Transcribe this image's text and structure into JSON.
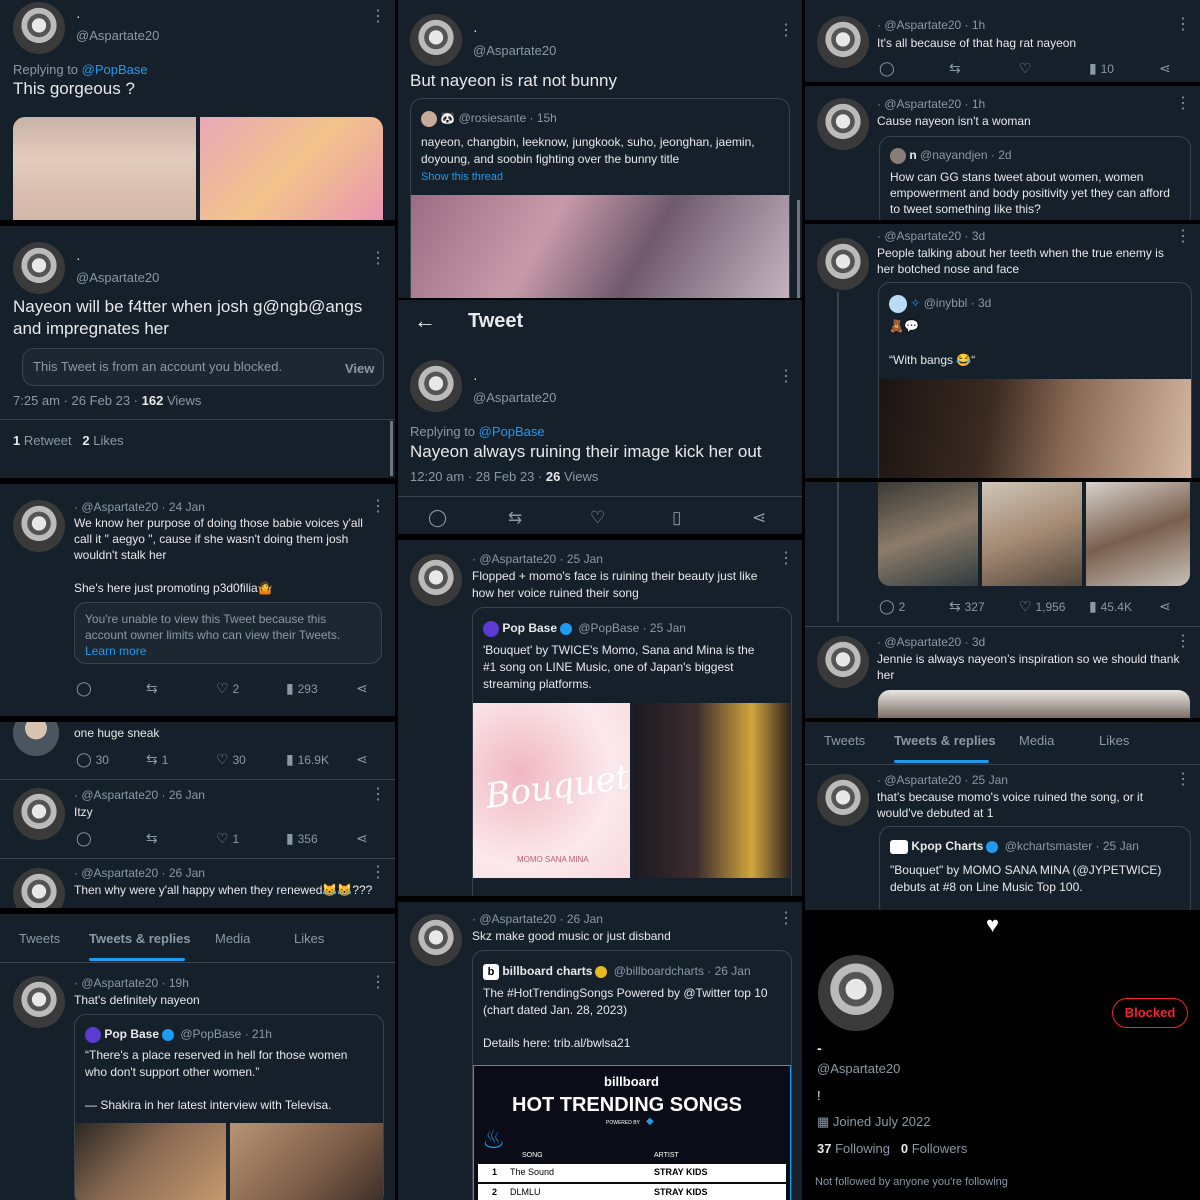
{
  "user": {
    "name": "·",
    "handle": "@Aspartate20"
  },
  "p1": {
    "replying": "Replying to",
    "replying_to": "@PopBase",
    "text": "This gorgeous ?"
  },
  "p2": {
    "text1": "Nayeon will be f4tter when josh g@ngb@angs",
    "text2": "and impregnates her",
    "blocked": "This Tweet is from an account you blocked.",
    "view": "View",
    "time": "7:25 am · 26 Feb 23 · ",
    "views_n": "162",
    "views": "Views",
    "rt_n": "1",
    "rt": "Retweet",
    "likes_n": "2",
    "likes": "Likes"
  },
  "p3": {
    "meta": "· @Aspartate20 · 24 Jan",
    "l1": "We know her purpose of doing those babie voices y'all",
    "l2": "call it \" aegyo \", cause if she wasn't doing them josh",
    "l3": "wouldn't stalk her",
    "l4": "She's here just promoting p3d0filia🤷",
    "q1": "You're unable to view this Tweet because this",
    "q2": "account owner limits who can view their Tweets.",
    "learn": "Learn more",
    "likes": "2",
    "views": "293"
  },
  "p4": {
    "text": "one huge sneak",
    "replies": "30",
    "rts": "1",
    "likes": "30",
    "views": "16.9K",
    "meta2": "· @Aspartate20 · 26 Jan",
    "text2": "Itzy",
    "likes2": "1",
    "views2": "356",
    "meta3": "· @Aspartate20 · 26 Jan",
    "text3": "Then why were y'all happy when they renewed😹😹???"
  },
  "p5": {
    "tabs": [
      "Tweets",
      "Tweets & replies",
      "Media",
      "Likes"
    ],
    "meta": "· @Aspartate20 · 19h",
    "text": "That's definitely nayeon",
    "q_name": "Pop Base",
    "q_meta": "@PopBase · 21h",
    "q1": "“There's a place reserved in hell for those women",
    "q2": "who don't support other women.”",
    "q3": "— Shakira in her latest interview with Televisa."
  },
  "p6": {
    "text": "But nayeon is rat not bunny",
    "q_meta": "@rosiesante · 15h",
    "q1": "nayeon, changbin, leeknow, jungkook, suho, jeonghan, jaemin,",
    "q2": "doyoung, and soobin fighting over the bunny title",
    "q_link": "Show this thread"
  },
  "p7": {
    "header": "Tweet",
    "replying": "Replying to",
    "replying_to": "@PopBase",
    "text": "Nayeon always ruining their image kick her out",
    "time": "12:20 am · 28 Feb 23 · ",
    "views_n": "26",
    "views": "Views"
  },
  "p8": {
    "meta": "· @Aspartate20 · 25 Jan",
    "l1": "Flopped + momo's face is ruining their beauty just like",
    "l2": "how her voice ruined their song",
    "q_name": "Pop Base",
    "q_meta": "@PopBase · 25 Jan",
    "q1": "'Bouquet' by TWICE's Momo, Sana and Mina is the",
    "q2": "#1 song on LINE Music, one of Japan's biggest",
    "q3": "streaming platforms.",
    "album": "Bouquet",
    "album_sub": "MOMO SANA MINA"
  },
  "p9": {
    "meta": "· @Aspartate20 · 26 Jan",
    "text": "Skz make good music or just disband",
    "q_name": "billboard charts",
    "q_meta": "@billboardcharts · 26 Jan",
    "q1": "The #HotTrendingSongs Powered by @Twitter top 10",
    "q2": "(chart dated Jan. 28, 2023)",
    "q3": "Details here:  trib.al/bwlsa21",
    "bb": "billboard",
    "bb_title": "HOT TRENDING SONGS",
    "bb_powered": "POWERED BY",
    "col_song": "SONG",
    "col_artist": "ARTIST",
    "rows": [
      {
        "n": "1",
        "song": "The Sound",
        "artist": "STRAY KIDS"
      },
      {
        "n": "2",
        "song": "DLMLU",
        "artist": "STRAY KIDS"
      }
    ]
  },
  "p10": {
    "meta": "· @Aspartate20 · 1h",
    "text": "It's all because of that hag rat nayeon",
    "views": "10"
  },
  "p11": {
    "meta": "· @Aspartate20 · 1h",
    "text": "Cause nayeon isn't a woman",
    "q_name": "n",
    "q_meta": "@nayandjen · 2d",
    "q1": "How can GG stans tweet about women,  women",
    "q2": "empowerment and body positivity yet they can afford",
    "q3": "to tweet something like this?"
  },
  "p12": {
    "meta": "· @Aspartate20 · 3d",
    "l1": "People talking about her teeth when the true enemy is",
    "l2": "her botched nose and face",
    "q_meta": "@inybbl · 3d",
    "q_text": "“With bangs 😂“"
  },
  "p13": {
    "replies": "2",
    "rts": "327",
    "likes": "1,956",
    "views": "45.4K",
    "meta": "· @Aspartate20 · 3d",
    "l1": "Jennie is always nayeon's inspiration so we should thank",
    "l2": "her"
  },
  "p14": {
    "tabs": [
      "Tweets",
      "Tweets & replies",
      "Media",
      "Likes"
    ],
    "meta": "· @Aspartate20 · 25 Jan",
    "l1": "that's because momo's voice ruined the song, or it",
    "l2": "would've debuted at 1",
    "q_name": "Kpop Charts",
    "q_meta": "@kchartsmaster · 25 Jan",
    "q1": "\"Bouquet\" by MOMO SANA MINA (@JYPETWICE)",
    "q2": "debuts at #8 on Line Music Top 100."
  },
  "p15": {
    "blocked": "Blocked",
    "name": "-",
    "handle": "@Aspartate20",
    "bio": "!",
    "joined": "Joined July 2022",
    "following_n": "37",
    "following": "Following",
    "followers_n": "0",
    "followers": "Followers",
    "not_followed": "Not followed by anyone you're following"
  },
  "colors": {
    "bg": "#15202b",
    "accent": "#1d9bf0",
    "muted": "#8b98a5",
    "blocked_red": "#f4212e"
  }
}
